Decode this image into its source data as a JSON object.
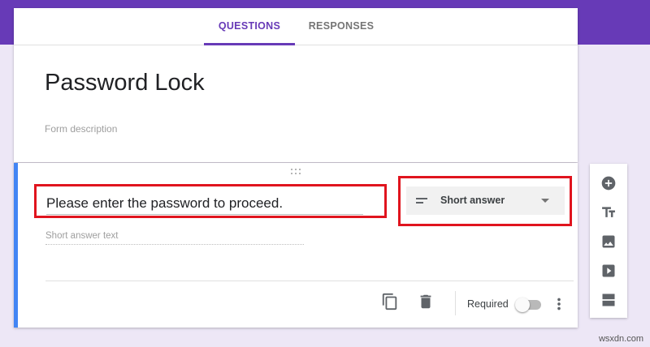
{
  "colors": {
    "accent": "#673ab7",
    "page_background": "#ede7f6",
    "highlight_frame": "#e0141e",
    "question_indicator": "#4285f4"
  },
  "tabs": [
    {
      "label": "QUESTIONS",
      "active": true
    },
    {
      "label": "RESPONSES",
      "active": false
    }
  ],
  "form": {
    "title": "Password Lock",
    "description_placeholder": "Form description"
  },
  "question": {
    "title": "Please enter the password to proceed.",
    "type": {
      "label": "Short answer",
      "icon": "short-text-icon"
    },
    "answer_placeholder": "Short answer text",
    "footer": {
      "duplicate_icon": "copy-icon",
      "delete_icon": "trash-icon",
      "required_label": "Required",
      "required_on": false,
      "more_icon": "more-vert-icon"
    }
  },
  "side_toolbar": {
    "items": [
      {
        "icon": "add-circle-icon"
      },
      {
        "icon": "title-text-icon"
      },
      {
        "icon": "image-icon"
      },
      {
        "icon": "video-icon"
      },
      {
        "icon": "section-icon"
      }
    ]
  },
  "watermark": "wsxdn.com"
}
